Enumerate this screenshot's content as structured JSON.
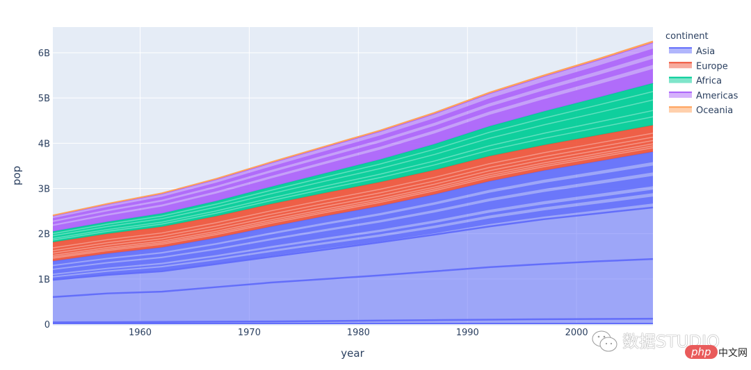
{
  "chart_data": {
    "type": "area",
    "stacked": true,
    "title": "",
    "xlabel": "year",
    "ylabel": "pop",
    "x": [
      1952,
      1957,
      1962,
      1967,
      1972,
      1977,
      1982,
      1987,
      1992,
      1997,
      2002,
      2007
    ],
    "xlim": [
      1952,
      2007
    ],
    "ylim": [
      0,
      6.6
    ],
    "y_unit": "billions",
    "xticks": [
      1960,
      1970,
      1980,
      1990,
      2000
    ],
    "xtick_labels": [
      "1960",
      "1970",
      "1980",
      "1990",
      "2000"
    ],
    "yticks": [
      0,
      1,
      2,
      3,
      4,
      5,
      6
    ],
    "ytick_labels": [
      "0",
      "1B",
      "2B",
      "3B",
      "4B",
      "5B",
      "6B"
    ],
    "grid": true,
    "legend": {
      "title": "continent",
      "position": "top-right"
    },
    "series": [
      {
        "name": "Asia",
        "color": "#636efa",
        "values": [
          1.395,
          1.562,
          1.697,
          1.91,
          2.157,
          2.391,
          2.614,
          2.87,
          3.159,
          3.397,
          3.602,
          3.812
        ]
      },
      {
        "name": "Europe",
        "color": "#ef553b",
        "values": [
          0.418,
          0.437,
          0.457,
          0.478,
          0.499,
          0.514,
          0.527,
          0.538,
          0.554,
          0.562,
          0.577,
          0.586
        ]
      },
      {
        "name": "Africa",
        "color": "#00cc96",
        "values": [
          0.237,
          0.265,
          0.296,
          0.335,
          0.38,
          0.435,
          0.5,
          0.575,
          0.66,
          0.744,
          0.834,
          0.93
        ]
      },
      {
        "name": "Americas",
        "color": "#ab63fa",
        "values": [
          0.345,
          0.386,
          0.433,
          0.48,
          0.531,
          0.578,
          0.625,
          0.674,
          0.726,
          0.776,
          0.829,
          0.899
        ]
      },
      {
        "name": "Oceania",
        "color": "#ffa15a",
        "values": [
          0.0107,
          0.0119,
          0.013,
          0.0145,
          0.0162,
          0.0175,
          0.0186,
          0.0203,
          0.0219,
          0.0234,
          0.0245,
          0.0247
        ]
      }
    ],
    "notable_lines": [
      {
        "name": "Asia inner boundary (low)",
        "continent": "Asia",
        "values": [
          0.04,
          0.045,
          0.05,
          0.055,
          0.06,
          0.07,
          0.08,
          0.09,
          0.1,
          0.11,
          0.115,
          0.12
        ]
      },
      {
        "name": "Asia inner boundary (China top)",
        "continent": "Asia",
        "values": [
          0.6,
          0.68,
          0.72,
          0.82,
          0.92,
          1.0,
          1.08,
          1.17,
          1.26,
          1.33,
          1.39,
          1.44
        ]
      },
      {
        "name": "Asia inner boundary (India top)",
        "continent": "Asia",
        "values": [
          0.98,
          1.09,
          1.17,
          1.33,
          1.49,
          1.65,
          1.81,
          1.98,
          2.16,
          2.32,
          2.45,
          2.58
        ]
      }
    ]
  },
  "watermark": {
    "text": "数据STUDIO",
    "badge": "php",
    "suffix": "中文网"
  }
}
